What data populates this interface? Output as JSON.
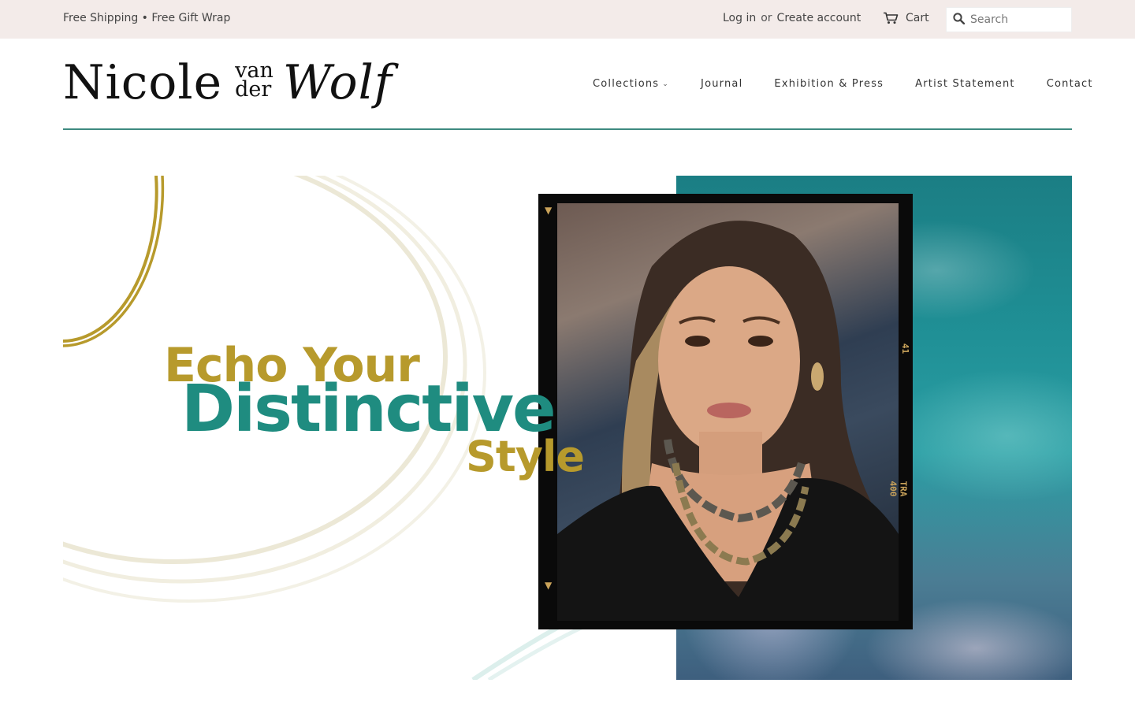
{
  "topbar": {
    "promo": "Free Shipping • Free Gift Wrap",
    "login": "Log in",
    "or": "or",
    "create_account": "Create account",
    "cart": "Cart",
    "search_placeholder": "Search",
    "background": "#f3ebe9"
  },
  "header": {
    "logo": {
      "word1": "Nicole",
      "word2a": "van",
      "word2b": "der",
      "word3": "Wolf"
    },
    "nav": [
      {
        "label": "Collections",
        "has_dropdown": true
      },
      {
        "label": "Journal"
      },
      {
        "label": "Exhibition & Press"
      },
      {
        "label": "Artist Statement"
      },
      {
        "label": "Contact"
      }
    ],
    "rule_color": "#3e8a80"
  },
  "hero": {
    "line1": "Echo Your",
    "line2": "Distinctive",
    "line3": "Style",
    "film_number": "41",
    "film_code": "TRA 400",
    "colors": {
      "gold": "#b79a2c",
      "teal": "#1f8c80",
      "ocean": "#1f8f95"
    }
  }
}
